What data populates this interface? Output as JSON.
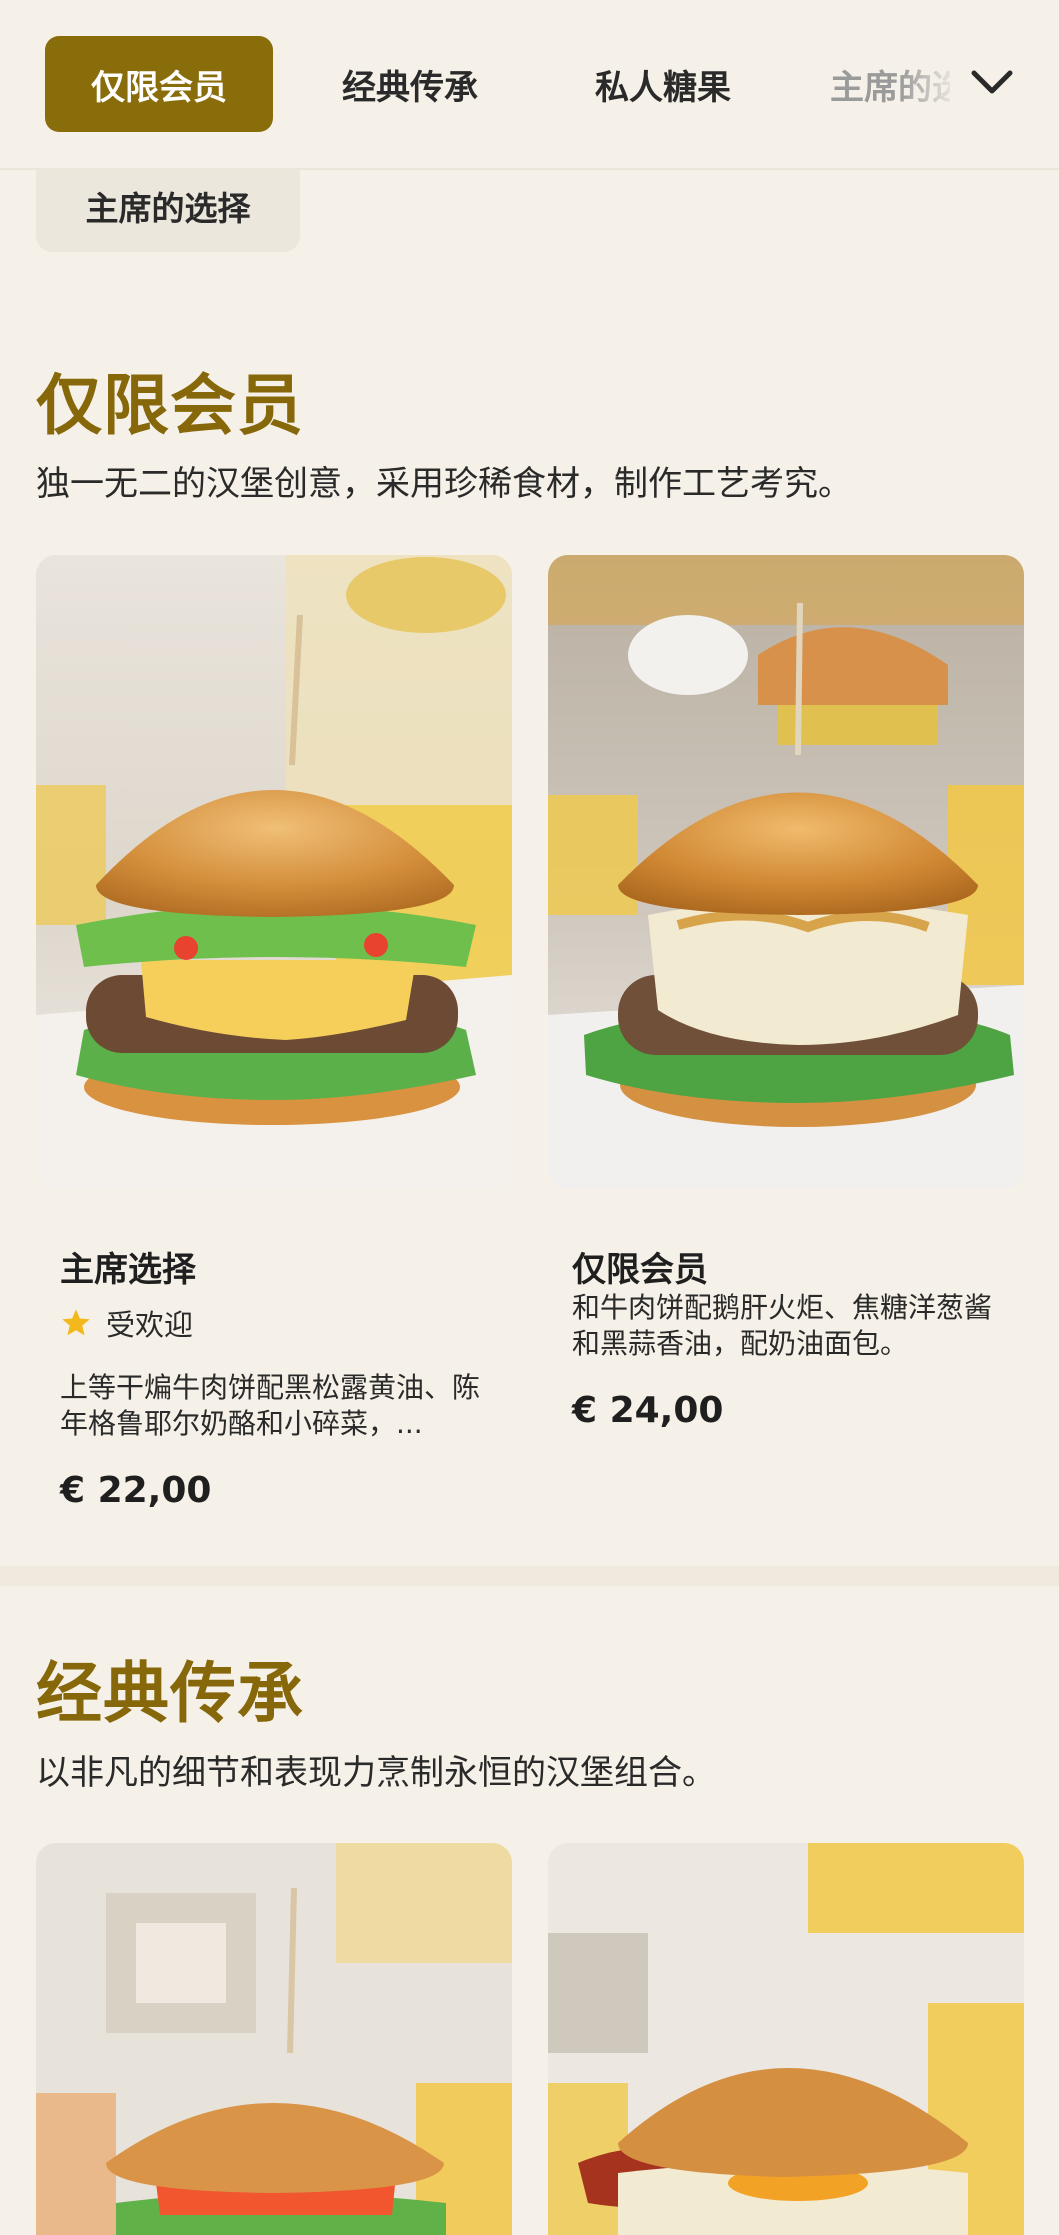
{
  "nav": {
    "tabs": [
      "仅限会员",
      "经典传承",
      "私人糖果",
      "主席的选择"
    ],
    "active_tab": "仅限会员",
    "overflow_chip": "主席的选择",
    "expand_icon": "chevron-down-icon"
  },
  "sections": [
    {
      "title": "仅限会员",
      "description": "独一无二的汉堡创意，采用珍稀食材，制作工艺考究。",
      "items": [
        {
          "name": "主席选择",
          "badge": "受欢迎",
          "badge_icon": "star-icon",
          "description": "上等干煸牛肉饼配黑松露黄油、陈年格鲁耶尔奶酪和小碎菜，...",
          "price": "€ 22,00"
        },
        {
          "name": "仅限会员",
          "description": "和牛肉饼配鹅肝火炬、焦糖洋葱酱和黑蒜香油，配奶油面包。",
          "price": "€ 24,00"
        }
      ]
    },
    {
      "title": "经典传承",
      "description": "以非凡的细节和表现力烹制永恒的汉堡组合。"
    }
  ],
  "colors": {
    "accent": "#8a6d0b",
    "heading": "#86680a",
    "background": "#f6f1e8",
    "star": "#f2b81c"
  }
}
